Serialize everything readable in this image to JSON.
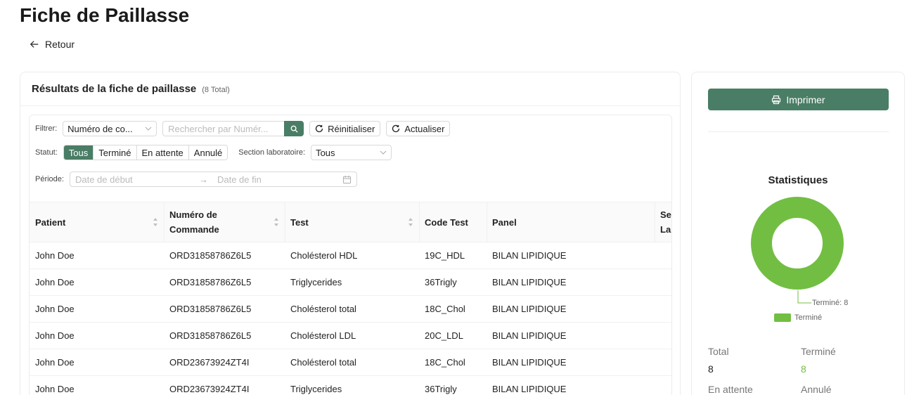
{
  "page": {
    "title": "Fiche de Paillasse",
    "back_label": "Retour"
  },
  "results": {
    "title": "Résultats de la fiche de paillasse",
    "count": "(8 Total)"
  },
  "filters": {
    "filter_label": "Filtrer:",
    "filter_field_value": "Numéro de co...",
    "search_placeholder": "Rechercher par Numér...",
    "reset_label": "Réinitialiser",
    "refresh_label": "Actualiser",
    "status_label": "Statut:",
    "status_options": [
      "Tous",
      "Terminé",
      "En attente",
      "Annulé"
    ],
    "status_selected": "Tous",
    "section_label": "Section laboratoire:",
    "section_value": "Tous",
    "period_label": "Période:",
    "date_start_placeholder": "Date de début",
    "date_end_placeholder": "Date de fin"
  },
  "table": {
    "columns": [
      "Patient",
      "Numéro de\nCommande",
      "Test",
      "Code Test",
      "Panel",
      "Se\nLab"
    ],
    "rows": [
      [
        "John Doe",
        "ORD31858786Z6L5",
        "Cholésterol HDL",
        "19C_HDL",
        "BILAN LIPIDIQUE"
      ],
      [
        "John Doe",
        "ORD31858786Z6L5",
        "Triglycerides",
        "36Trigly",
        "BILAN LIPIDIQUE"
      ],
      [
        "John Doe",
        "ORD31858786Z6L5",
        "Cholésterol total",
        "18C_Chol",
        "BILAN LIPIDIQUE"
      ],
      [
        "John Doe",
        "ORD31858786Z6L5",
        "Cholésterol LDL",
        "20C_LDL",
        "BILAN LIPIDIQUE"
      ],
      [
        "John Doe",
        "ORD23673924ZT4I",
        "Cholésterol total",
        "18C_Chol",
        "BILAN LIPIDIQUE"
      ],
      [
        "John Doe",
        "ORD23673924ZT4I",
        "Triglycerides",
        "36Trigly",
        "BILAN LIPIDIQUE"
      ]
    ]
  },
  "side": {
    "print_label": "Imprimer",
    "stats_title": "Statistiques",
    "donut_label": "Terminé: 8",
    "legend_label": "Terminé",
    "total_label": "Total",
    "total_value": "8",
    "done_label": "Terminé",
    "done_value": "8",
    "pending_label": "En attente",
    "cancelled_label": "Annulé"
  },
  "colors": {
    "accent": "#4a7d65",
    "chart_green": "#72be43"
  }
}
